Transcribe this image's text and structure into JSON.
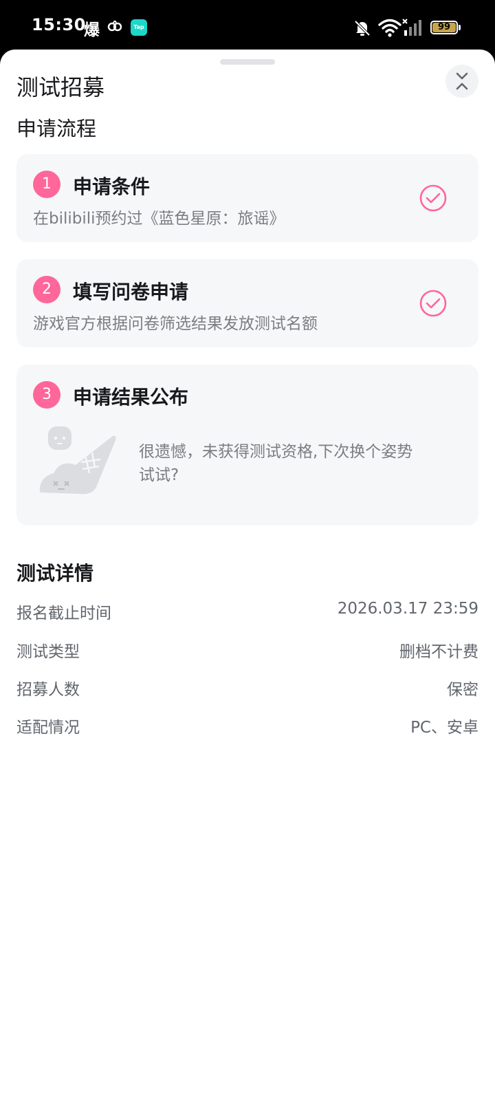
{
  "status_bar": {
    "time": "15:30",
    "battery": "99",
    "app_badge": "Tap",
    "notif_glyph_1": "爆"
  },
  "sheet": {
    "title": "测试招募",
    "section_title": "申请流程"
  },
  "steps": [
    {
      "number": "1",
      "title": "申请条件",
      "description": "在bilibili预约过《蓝色星原：旅谣》",
      "status": "done"
    },
    {
      "number": "2",
      "title": "填写问卷申请",
      "description": "游戏官方根据问卷筛选结果发放测试名额",
      "status": "done"
    },
    {
      "number": "3",
      "title": "申请结果公布",
      "message": "很遗憾，未获得测试资格,下次换个姿势试试?",
      "status": "failed"
    }
  ],
  "details": {
    "title": "测试详情",
    "rows": [
      {
        "label": "报名截止时间",
        "value": "2026.03.17 23:59"
      },
      {
        "label": "测试类型",
        "value": "删档不计费"
      },
      {
        "label": "招募人数",
        "value": "保密"
      },
      {
        "label": "适配情况",
        "value": "PC、安卓"
      }
    ]
  },
  "colors": {
    "accent": "#ff6699",
    "card_bg": "#f6f7f8",
    "text_primary": "#18191c",
    "text_secondary": "#7a7d82"
  },
  "icons": [
    "bell-off-icon",
    "wifi-icon",
    "signal-icon",
    "battery-icon",
    "collapse-chevrons-icon",
    "check-circle-icon",
    "sad-ghost-illustration"
  ]
}
